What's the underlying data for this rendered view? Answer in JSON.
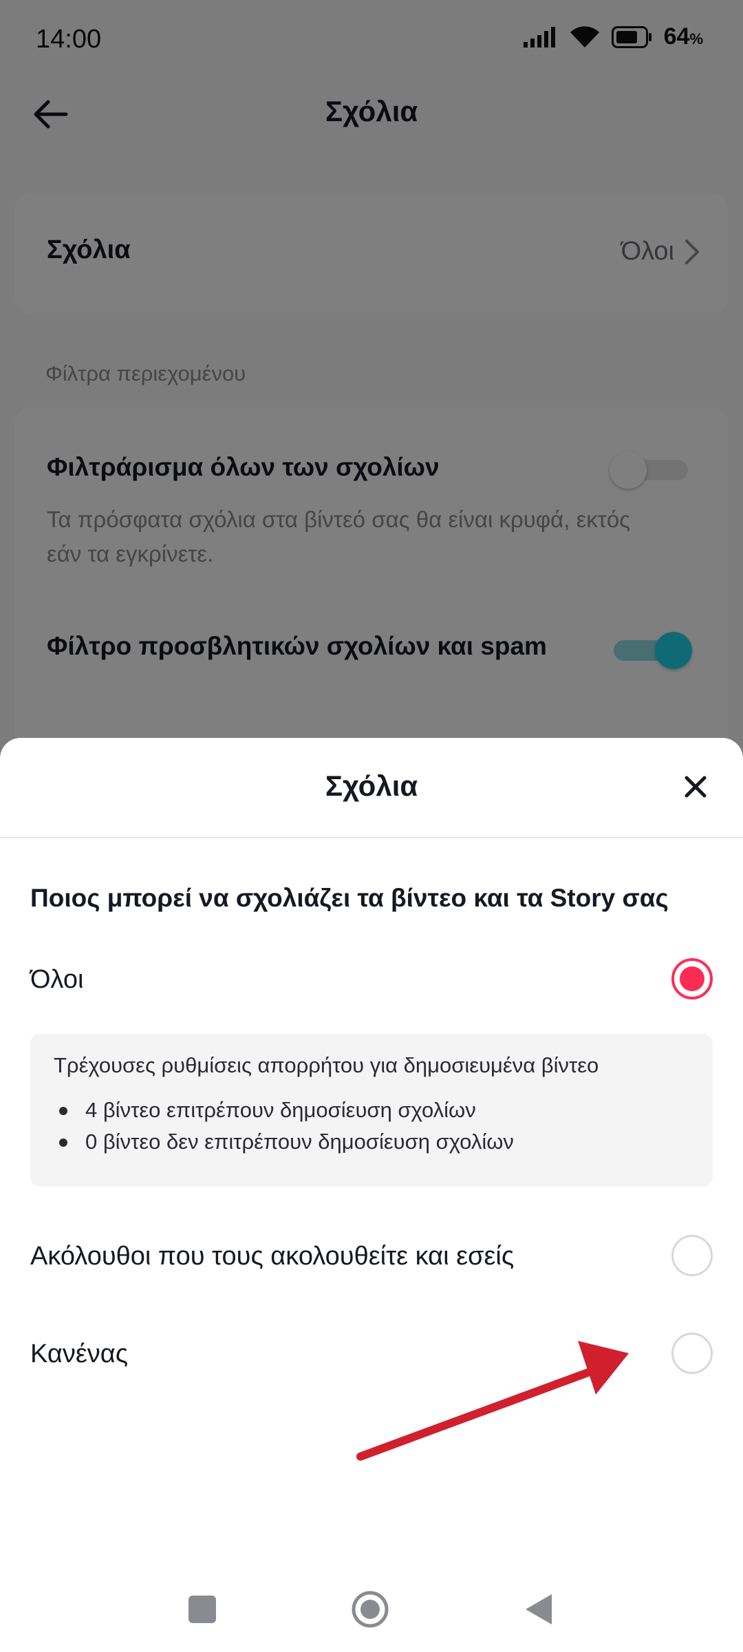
{
  "status_bar": {
    "time": "14:00",
    "battery_percent": "64",
    "battery_unit": "%",
    "icons": [
      "signal-icon",
      "wifi-icon",
      "battery-icon"
    ]
  },
  "header": {
    "title": "Σχόλια",
    "back_icon": "arrow-left-icon"
  },
  "comments_row": {
    "label": "Σχόλια",
    "value": "Όλοι"
  },
  "content_filters": {
    "section_title": "Φίλτρα περιεχομένου",
    "items": [
      {
        "title": "Φιλτράρισμα όλων των σχολίων",
        "description": "Τα πρόσφατα σχόλια στα βίντεό σας θα είναι κρυφά, εκτός εάν τα εγκρίνετε.",
        "enabled": false
      },
      {
        "title": "Φίλτρο προσβλητικών σχολίων και spam",
        "enabled": true
      }
    ]
  },
  "sheet": {
    "title": "Σχόλια",
    "question": "Ποιος μπορεί να σχολιάζει τα βίντεο και τα Story σας",
    "options": [
      {
        "label": "Όλοι",
        "selected": true
      },
      {
        "label": "Ακόλουθοι που τους ακολουθείτε και εσείς",
        "selected": false
      },
      {
        "label": "Κανένας",
        "selected": false
      }
    ],
    "info": {
      "title": "Τρέχουσες ρυθμίσεις απορρήτου για δημοσιευμένα βίντεο",
      "items": [
        "4 βίντεο επιτρέπουν δημοσίευση σχολίων",
        "0 βίντεο δεν επιτρέπουν δημοσίευση σχολίων"
      ]
    }
  },
  "annotation": {
    "arrow_color": "#d0202e"
  },
  "colors": {
    "accent": "#fe2c55",
    "toggle_on": "#20d5ec"
  },
  "nav_bar": {
    "icons": [
      "recent-apps-icon",
      "home-icon",
      "back-icon"
    ]
  }
}
